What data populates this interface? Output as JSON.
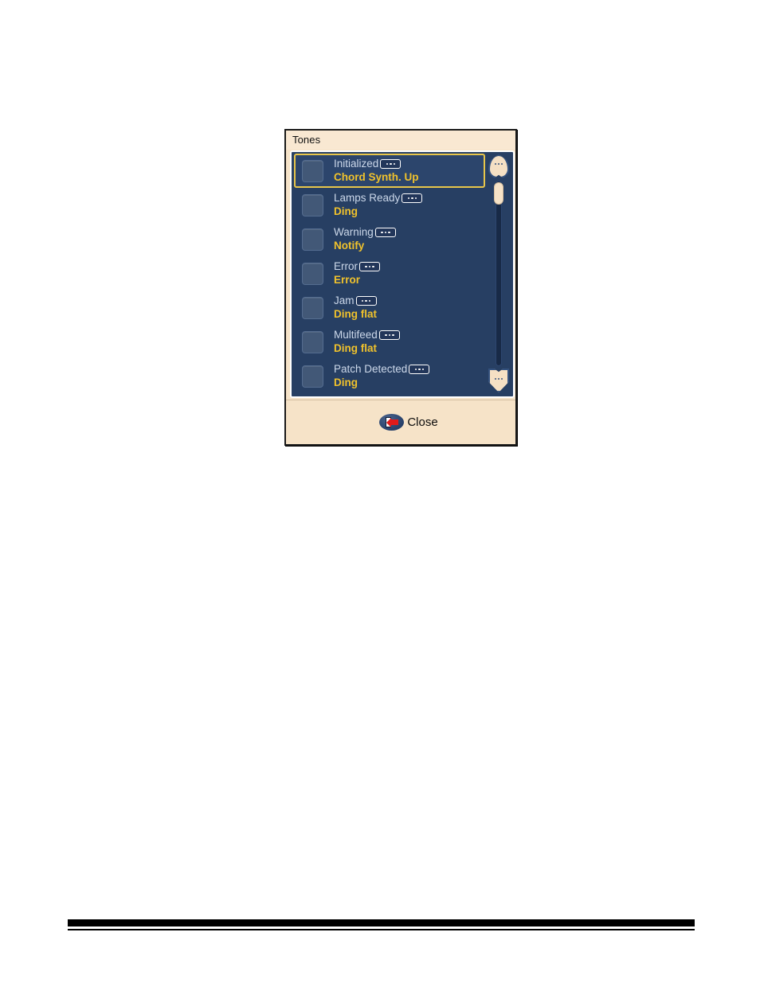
{
  "dialog": {
    "title": "Tones",
    "footer": {
      "close_label": "Close",
      "close_icon": "exit-door-icon"
    },
    "scrollbar": {
      "up_icon": "scroll-up-arrow-icon",
      "down_icon": "scroll-down-arrow-icon",
      "thumb_position_percent": 4
    },
    "list": {
      "badge_icon": "ellipsis-badge-icon",
      "rows": [
        {
          "name": "Initialized",
          "value": "Chord Synth. Up",
          "selected": true,
          "checked": false
        },
        {
          "name": "Lamps Ready",
          "value": "Ding",
          "selected": false,
          "checked": false
        },
        {
          "name": "Warning",
          "value": "Notify",
          "selected": false,
          "checked": false
        },
        {
          "name": "Error",
          "value": "Error",
          "selected": false,
          "checked": false
        },
        {
          "name": "Jam",
          "value": "Ding flat",
          "selected": false,
          "checked": false
        },
        {
          "name": "Multifeed",
          "value": "Ding flat",
          "selected": false,
          "checked": false
        },
        {
          "name": "Patch Detected",
          "value": "Ding",
          "selected": false,
          "checked": false
        }
      ]
    }
  },
  "colors": {
    "panel_background": "#273f63",
    "dialog_frame": "#f6e3c8",
    "selection_border": "#e8c64a",
    "value_text": "#f0c22c",
    "name_text": "#ccd8ea",
    "accent_red": "#e01b1b"
  }
}
